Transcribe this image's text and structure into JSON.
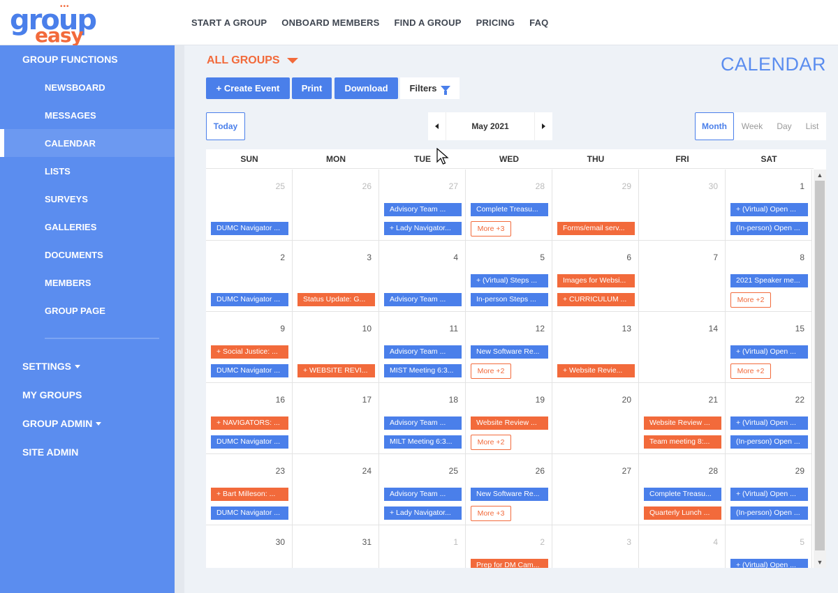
{
  "logo": {
    "top": "group",
    "bottom": "easy",
    "dots": "•••"
  },
  "topnav": [
    "START A GROUP",
    "ONBOARD MEMBERS",
    "FIND A GROUP",
    "PRICING",
    "FAQ"
  ],
  "sidebar": {
    "section": "GROUP FUNCTIONS",
    "items": [
      "NEWSBOARD",
      "MESSAGES",
      "CALENDAR",
      "LISTS",
      "SURVEYS",
      "GALLERIES",
      "DOCUMENTS",
      "MEMBERS",
      "GROUP PAGE"
    ],
    "active": "CALENDAR",
    "settings": "SETTINGS",
    "my_groups": "MY GROUPS",
    "group_admin": "GROUP ADMIN",
    "site_admin": "SITE ADMIN"
  },
  "main": {
    "groups_selector": "ALL GROUPS",
    "page_title": "CALENDAR",
    "toolbar": {
      "create": "+ Create Event",
      "print": "Print",
      "download": "Download",
      "filters": "Filters"
    },
    "today": "Today",
    "month_label": "May 2021",
    "views": [
      "Month",
      "Week",
      "Day",
      "List"
    ],
    "active_view": "Month"
  },
  "colors": {
    "blue": "#4a7fea",
    "orange": "#f26a3b",
    "sidebar": "#5b8def"
  },
  "calendar": {
    "weekdays": [
      "SUN",
      "MON",
      "TUE",
      "WED",
      "THU",
      "FRI",
      "SAT"
    ],
    "weeks": [
      [
        {
          "day": "25",
          "other": true,
          "events": [
            {
              "slot": 2,
              "text": "DUMC Navigator ...",
              "color": "blue"
            }
          ]
        },
        {
          "day": "26",
          "other": true,
          "events": []
        },
        {
          "day": "27",
          "other": true,
          "events": [
            {
              "slot": 1,
              "text": "Advisory Team ...",
              "color": "blue"
            },
            {
              "slot": 2,
              "text": "+ Lady Navigator...",
              "color": "blue"
            }
          ]
        },
        {
          "day": "28",
          "other": true,
          "events": [
            {
              "slot": 1,
              "text": "Complete Treasu...",
              "color": "blue"
            }
          ],
          "more": "More +3"
        },
        {
          "day": "29",
          "other": true,
          "events": [
            {
              "slot": 2,
              "text": "Forms/email serv...",
              "color": "orange"
            }
          ]
        },
        {
          "day": "30",
          "other": true,
          "events": []
        },
        {
          "day": "1",
          "other": false,
          "events": [
            {
              "slot": 1,
              "text": "+ (Virtual) Open ...",
              "color": "blue"
            },
            {
              "slot": 2,
              "text": "(In-person) Open ...",
              "color": "blue"
            }
          ]
        }
      ],
      [
        {
          "day": "2",
          "other": false,
          "events": [
            {
              "slot": 2,
              "text": "DUMC Navigator ...",
              "color": "blue"
            }
          ]
        },
        {
          "day": "3",
          "other": false,
          "events": [
            {
              "slot": 2,
              "text": "Status Update: G...",
              "color": "orange"
            }
          ]
        },
        {
          "day": "4",
          "other": false,
          "events": [
            {
              "slot": 2,
              "text": "Advisory Team ...",
              "color": "blue"
            }
          ]
        },
        {
          "day": "5",
          "other": false,
          "events": [
            {
              "slot": 1,
              "text": "+ (Virtual) Steps ...",
              "color": "blue"
            },
            {
              "slot": 2,
              "text": "In-person Steps ...",
              "color": "blue"
            }
          ]
        },
        {
          "day": "6",
          "other": false,
          "events": [
            {
              "slot": 1,
              "text": "Images for Websi...",
              "color": "orange"
            },
            {
              "slot": 2,
              "text": "+ CURRICULUM ...",
              "color": "orange"
            }
          ]
        },
        {
          "day": "7",
          "other": false,
          "events": []
        },
        {
          "day": "8",
          "other": false,
          "events": [
            {
              "slot": 1,
              "text": "2021 Speaker me...",
              "color": "blue"
            }
          ],
          "more": "More +2"
        }
      ],
      [
        {
          "day": "9",
          "other": false,
          "events": [
            {
              "slot": 1,
              "text": "+ Social Justice: ...",
              "color": "orange"
            },
            {
              "slot": 2,
              "text": "DUMC Navigator ...",
              "color": "blue"
            }
          ]
        },
        {
          "day": "10",
          "other": false,
          "events": [
            {
              "slot": 2,
              "text": "+ WEBSITE REVI...",
              "color": "orange"
            }
          ]
        },
        {
          "day": "11",
          "other": false,
          "events": [
            {
              "slot": 1,
              "text": "Advisory Team ...",
              "color": "blue"
            },
            {
              "slot": 2,
              "text": "MIST Meeting 6:3...",
              "color": "blue"
            }
          ]
        },
        {
          "day": "12",
          "other": false,
          "events": [
            {
              "slot": 1,
              "text": "New Software Re...",
              "color": "blue"
            }
          ],
          "more": "More +2"
        },
        {
          "day": "13",
          "other": false,
          "events": [
            {
              "slot": 2,
              "text": "+ Website Revie...",
              "color": "orange"
            }
          ]
        },
        {
          "day": "14",
          "other": false,
          "events": []
        },
        {
          "day": "15",
          "other": false,
          "events": [
            {
              "slot": 1,
              "text": "+ (Virtual) Open ...",
              "color": "blue"
            }
          ],
          "more": "More +2"
        }
      ],
      [
        {
          "day": "16",
          "other": false,
          "events": [
            {
              "slot": 1,
              "text": "+ NAVIGATORS: ...",
              "color": "orange"
            },
            {
              "slot": 2,
              "text": "DUMC Navigator ...",
              "color": "blue"
            }
          ]
        },
        {
          "day": "17",
          "other": false,
          "events": []
        },
        {
          "day": "18",
          "other": false,
          "events": [
            {
              "slot": 1,
              "text": "Advisory Team ...",
              "color": "blue"
            },
            {
              "slot": 2,
              "text": "MILT Meeting 6:3...",
              "color": "blue"
            }
          ]
        },
        {
          "day": "19",
          "other": false,
          "events": [
            {
              "slot": 1,
              "text": "Website Review ...",
              "color": "orange"
            }
          ],
          "more": "More +2"
        },
        {
          "day": "20",
          "other": false,
          "events": []
        },
        {
          "day": "21",
          "other": false,
          "events": [
            {
              "slot": 1,
              "text": "Website Review ...",
              "color": "orange"
            },
            {
              "slot": 2,
              "text": "Team meeting 8:...",
              "color": "orange"
            }
          ]
        },
        {
          "day": "22",
          "other": false,
          "events": [
            {
              "slot": 1,
              "text": "+ (Virtual) Open ...",
              "color": "blue"
            },
            {
              "slot": 2,
              "text": "(In-person) Open ...",
              "color": "blue"
            }
          ]
        }
      ],
      [
        {
          "day": "23",
          "other": false,
          "events": [
            {
              "slot": 1,
              "text": "+ Bart Milleson: ...",
              "color": "orange"
            },
            {
              "slot": 2,
              "text": "DUMC Navigator ...",
              "color": "blue"
            }
          ]
        },
        {
          "day": "24",
          "other": false,
          "events": []
        },
        {
          "day": "25",
          "other": false,
          "events": [
            {
              "slot": 1,
              "text": "Advisory Team ...",
              "color": "blue"
            },
            {
              "slot": 2,
              "text": "+ Lady Navigator...",
              "color": "blue"
            }
          ]
        },
        {
          "day": "26",
          "other": false,
          "events": [
            {
              "slot": 1,
              "text": "New Software Re...",
              "color": "blue"
            }
          ],
          "more": "More +3"
        },
        {
          "day": "27",
          "other": false,
          "events": []
        },
        {
          "day": "28",
          "other": false,
          "events": [
            {
              "slot": 1,
              "text": "Complete Treasu...",
              "color": "blue"
            },
            {
              "slot": 2,
              "text": "Quarterly Lunch ...",
              "color": "orange"
            }
          ]
        },
        {
          "day": "29",
          "other": false,
          "events": [
            {
              "slot": 1,
              "text": "+ (Virtual) Open ...",
              "color": "blue"
            },
            {
              "slot": 2,
              "text": "(In-person) Open ...",
              "color": "blue"
            }
          ]
        }
      ],
      [
        {
          "day": "30",
          "other": false,
          "events": []
        },
        {
          "day": "31",
          "other": false,
          "events": []
        },
        {
          "day": "1",
          "other": true,
          "events": []
        },
        {
          "day": "2",
          "other": true,
          "events": [
            {
              "slot": 1,
              "text": "Prep for DM Cam...",
              "color": "orange"
            }
          ]
        },
        {
          "day": "3",
          "other": true,
          "events": []
        },
        {
          "day": "4",
          "other": true,
          "events": []
        },
        {
          "day": "5",
          "other": true,
          "events": [
            {
              "slot": 1,
              "text": "+ (Virtual) Open ...",
              "color": "blue"
            }
          ]
        }
      ]
    ]
  }
}
